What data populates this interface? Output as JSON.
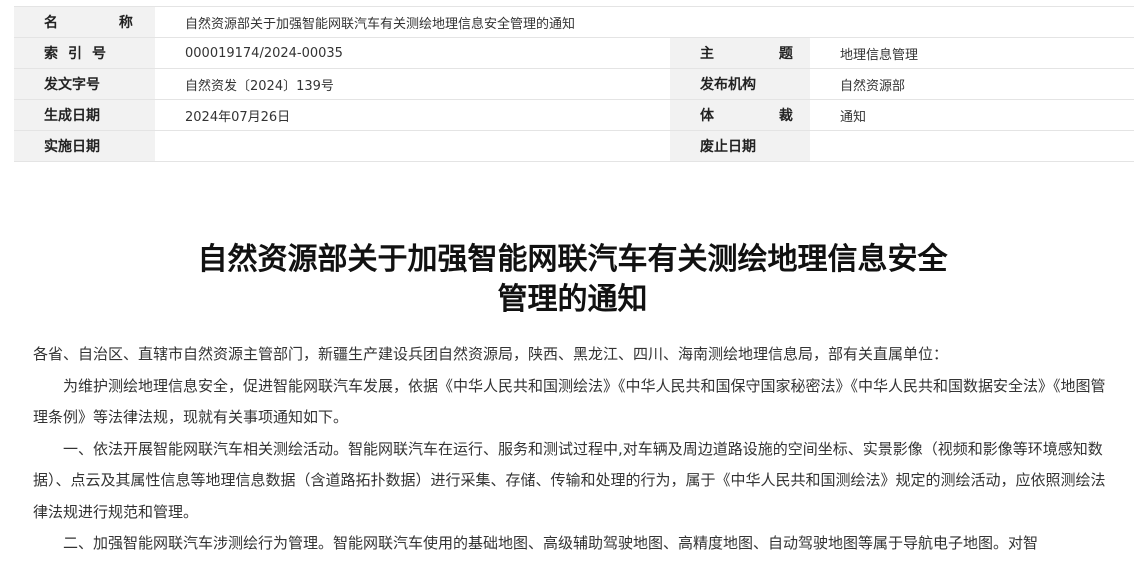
{
  "meta": {
    "name_label": "名 称",
    "name_value": "自然资源部关于加强智能网联汽车有关测绘地理信息安全管理的通知",
    "index_label": "索引号",
    "index_value": "000019174/2024-00035",
    "subject_label": "主 题",
    "subject_value": "地理信息管理",
    "docno_label": "发文字号",
    "docno_value": "自然资发〔2024〕139号",
    "issuer_label": "发布机构",
    "issuer_value": "自然资源部",
    "date_label": "生成日期",
    "date_value": "2024年07月26日",
    "genre_label": "体 裁",
    "genre_value": "通知",
    "effective_label": "实施日期",
    "effective_value": "",
    "expire_label": "废止日期",
    "expire_value": ""
  },
  "title": {
    "line1": "自然资源部关于加强智能网联汽车有关测绘地理信息安全",
    "line2": "管理的通知"
  },
  "body": {
    "salutation": "各省、自治区、直辖市自然资源主管部门，新疆生产建设兵团自然资源局，陕西、黑龙江、四川、海南测绘地理信息局，部有关直属单位：",
    "para1": "为维护测绘地理信息安全，促进智能网联汽车发展，依据《中华人民共和国测绘法》《中华人民共和国保守国家秘密法》《中华人民共和国数据安全法》《地图管理条例》等法律法规，现就有关事项通知如下。",
    "para2": "一、依法开展智能网联汽车相关测绘活动。智能网联汽车在运行、服务和测试过程中,对车辆及周边道路设施的空间坐标、实景影像（视频和影像等环境感知数据）、点云及其属性信息等地理信息数据（含道路拓扑数据）进行采集、存储、传输和处理的行为，属于《中华人民共和国测绘法》规定的测绘活动，应依照测绘法律法规进行规范和管理。",
    "para3": "二、加强智能网联汽车涉测绘行为管理。智能网联汽车使用的基础地图、高级辅助驾驶地图、高精度地图、自动驾驶地图等属于导航电子地图。对智"
  }
}
